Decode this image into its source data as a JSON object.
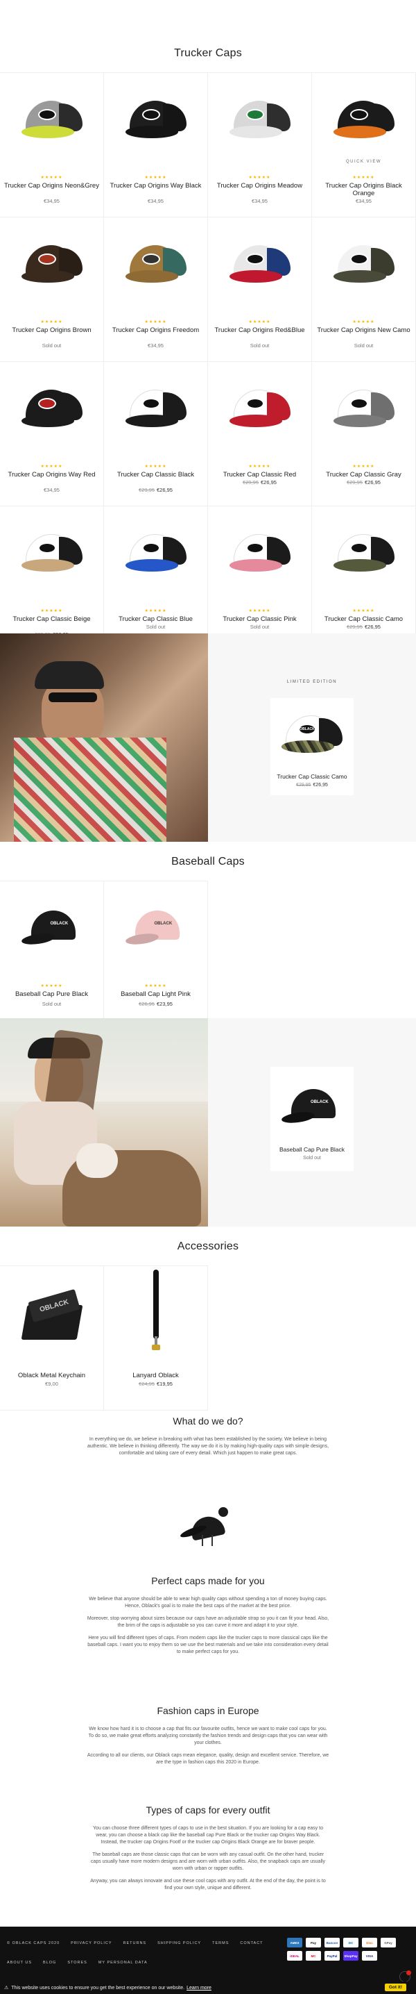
{
  "trucker": {
    "title": "Trucker Caps",
    "quick_view": "QUICK VIEW",
    "products": [
      {
        "name": "Trucker Cap Origins Neon&Grey",
        "price": "€34,95",
        "crown": "#9a9a9a",
        "mesh": "#2b2b2b",
        "brim": "#cddc39",
        "patch": "#111"
      },
      {
        "name": "Trucker Cap Origins Way Black",
        "price": "€34,95",
        "crown": "#1e1e1e",
        "mesh": "#151515",
        "brim": "#151515",
        "patch": "#111"
      },
      {
        "name": "Trucker Cap Origins Meadow",
        "price": "€34,95",
        "crown": "#d8d8d8",
        "mesh": "#2e2e2e",
        "brim": "#e6e6e6",
        "patch": "#1f7a3a"
      },
      {
        "name": "Trucker Cap Origins Black Orange",
        "price": "€34,95",
        "crown": "#1b1b1b",
        "mesh": "#1b1b1b",
        "brim": "#e0701a",
        "patch": "#111"
      },
      {
        "name": "Trucker Cap Origins Brown",
        "price": "Sold out",
        "crown": "#3a2a1e",
        "mesh": "#2a1f17",
        "brim": "#3a2a1e",
        "patch": "#a3341f"
      },
      {
        "name": "Trucker Cap Origins Freedom",
        "price": "€34,95",
        "crown": "#a0783c",
        "mesh": "#36695f",
        "brim": "#8e6a34",
        "patch": "#333"
      },
      {
        "name": "Trucker Cap Origins Red&Blue",
        "price": "Sold out",
        "crown": "#e8e8e8",
        "mesh": "#1e3a78",
        "brim": "#c0182e",
        "patch": "#111"
      },
      {
        "name": "Trucker Cap Origins New Camo",
        "price": "Sold out",
        "crown": "#f2f2f2",
        "mesh": "#3b3b2e",
        "brim": "#4a4a3a",
        "patch": "#111"
      },
      {
        "name": "Trucker Cap Origins Way Red",
        "price": "€34,95",
        "crown": "#1b1b1b",
        "mesh": "#1b1b1b",
        "brim": "#1b1b1b",
        "patch": "#b52020"
      },
      {
        "name": "Trucker Cap Classic Black",
        "old_price": "€29,95",
        "sale_price": "€26,95",
        "crown": "#ffffff",
        "mesh": "#1b1b1b",
        "brim": "#1b1b1b",
        "patch": "#111"
      },
      {
        "name": "Trucker Cap Classic Red",
        "old_price": "€29,95",
        "sale_price": "€26,95",
        "crown": "#ffffff",
        "mesh": "#c01d2c",
        "brim": "#c01d2c",
        "patch": "#111"
      },
      {
        "name": "Trucker Cap Classic Gray",
        "old_price": "€29,95",
        "sale_price": "€26,95",
        "crown": "#ffffff",
        "mesh": "#6f6f6f",
        "brim": "#7a7a7a",
        "patch": "#111"
      },
      {
        "name": "Trucker Cap Classic Beige",
        "old_price": "€29,95",
        "sale_price": "€26,95",
        "crown": "#ffffff",
        "mesh": "#1b1b1b",
        "brim": "#c9a77c",
        "patch": "#111"
      },
      {
        "name": "Trucker Cap Classic Blue",
        "price": "Sold out",
        "crown": "#ffffff",
        "mesh": "#1b1b1b",
        "brim": "#2657c9",
        "patch": "#111"
      },
      {
        "name": "Trucker Cap Classic Pink",
        "price": "Sold out",
        "crown": "#ffffff",
        "mesh": "#1b1b1b",
        "brim": "#e58a9a",
        "patch": "#111"
      },
      {
        "name": "Trucker Cap Classic Camo",
        "old_price": "€29,95",
        "sale_price": "€26,95",
        "crown": "#ffffff",
        "mesh": "#1b1b1b",
        "brim": "#565a3c",
        "patch": "#111"
      }
    ]
  },
  "limited": {
    "label": "LIMITED EDITION",
    "name": "Trucker Cap Classic Camo",
    "old_price": "€29,95",
    "sale_price": "€26,95"
  },
  "baseball": {
    "title": "Baseball Caps",
    "products": [
      {
        "name": "Baseball Cap Pure Black",
        "price": "Sold out",
        "color": "#1b1b1b",
        "logo": "OBLACK"
      },
      {
        "name": "Baseball Cap Light Pink",
        "old_price": "€26,95",
        "sale_price": "€23,95",
        "color": "#f2c6c4",
        "logo": "OBLACK"
      }
    ]
  },
  "featured": {
    "name": "Baseball Cap Pure Black",
    "price": "Sold out"
  },
  "accessories": {
    "title": "Accessories",
    "products": [
      {
        "name": "Oblack Metal Keychain",
        "price": "€9,00",
        "logo": "OBLACK"
      },
      {
        "name": "Lanyard Oblack",
        "old_price": "€24,95",
        "sale_price": "€19,95"
      }
    ]
  },
  "about": {
    "what_title": "What do we do?",
    "what_p1": "In everything we do, we believe in breaking with what has been established by the society. We believe in being authentic. We believe in thinking differently. The way we do it is by making high-quality caps with simple designs, comfortable and taking care of every detail. Which just happen to make great caps.",
    "perfect_title": "Perfect caps made for you",
    "perfect_p1": "We believe that anyone should be able to wear high quality caps without spending a ton of money buying caps. Hence, Oblack's goal is to make the best caps of the market at the best price.",
    "perfect_p2": "Moreover, stop worrying about sizes because our caps have an adjustable strap so you it can fit your head. Also, the brim of the caps is adjustable so you can curve it more and adapt it to your style.",
    "perfect_p3": "Here you will find different types of caps. From modern caps like the trucker caps to more classical caps like the baseball caps. I want you to enjoy them so we use the best materials and we take into consideration every detail to make perfect caps for you.",
    "fashion_title": "Fashion caps in Europe",
    "fashion_p1": "We know how hard it is to choose a cap that fits our favourite outfits, hence we want to make cool caps for you. To do so, we make great efforts analyzing constantly the fashion trends and design caps that you can wear with your clothes.",
    "fashion_p2": "According to all our clients, our Oblack caps mean elegance, quality, design and excellent service. Therefore, we are the type in fashion caps this 2020 in Europe.",
    "types_title": "Types of caps for every outfit",
    "types_p1": "You can choose three different types of caps to use in the best situation. If you are looking for a cap easy to wear, you can choose a black cap like the baseball cap Pure Black or the trucker cap Origins Way Black. Instead, the trucker cap Origins Footf or the trucker cap Origins Black Orange are for braver people.",
    "types_p2": "The baseball caps are those classic caps that can be worn with any casual outfit. On the other hand, trucker caps usually have more modern designs and are worn with urban outfits. Also, the snapback caps are usually worn with urban or rapper outfits.",
    "types_p3": "Anyway, you can always innovate and use these cool caps with any outfit. At the end of the day, the point is to find your own style, unique and different."
  },
  "footer": {
    "links": [
      "© OBLACK CAPS 2020",
      "PRIVACY POLICY",
      "RETURNS",
      "SHIPPING POLICY",
      "TERMS",
      "CONTACT"
    ],
    "links2": [
      "ABOUT US",
      "BLOG",
      "STORES",
      "MY PERSONAL DATA"
    ],
    "payments": [
      "AMEX",
      "Pay",
      "Bancon",
      "DC",
      "Disc",
      "GPay",
      "iDEAL",
      "MC",
      "PayPal",
      "ShopPay",
      "VISA"
    ]
  },
  "cookie": {
    "text": "This website uses cookies to ensure you get the best experience on our website.",
    "learn_more": "Learn more",
    "button": "Got it!"
  },
  "stars": "★★★★★"
}
